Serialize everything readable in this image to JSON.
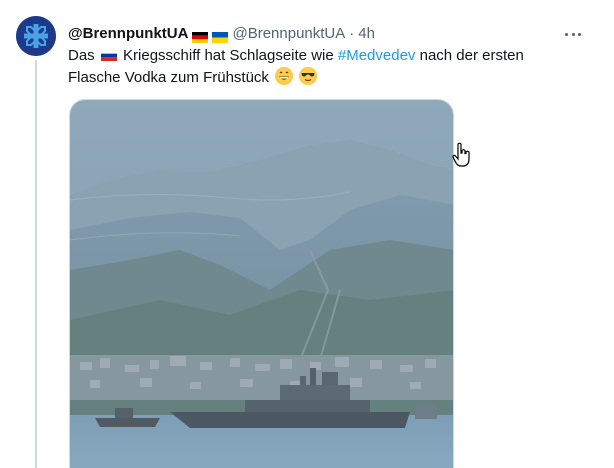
{
  "tweet": {
    "display_name": "@BrennpunktUA",
    "handle": "@BrennpunktUA",
    "separator": "·",
    "time": "4h",
    "text_part1": "Das",
    "text_part2": "Kriegsschiff hat Schlagseite wie",
    "hashtag": "#Medvedev",
    "text_part3": "nach der ersten",
    "text_line2": "Flasche Vodka zum Frühstück",
    "icons": {
      "more": "more-options-icon",
      "flag_de": "germany-flag-icon",
      "flag_ua": "ukraine-flag-icon",
      "flag_ru": "russia-flag-icon",
      "emoji_1": "grinning-face-emoji",
      "emoji_2": "sunglasses-face-emoji",
      "cursor": "hand-pointer-cursor-icon"
    }
  },
  "colors": {
    "hashtag": "#1d9bf0",
    "secondary_text": "#536471",
    "thread_line": "#cfd9de"
  }
}
